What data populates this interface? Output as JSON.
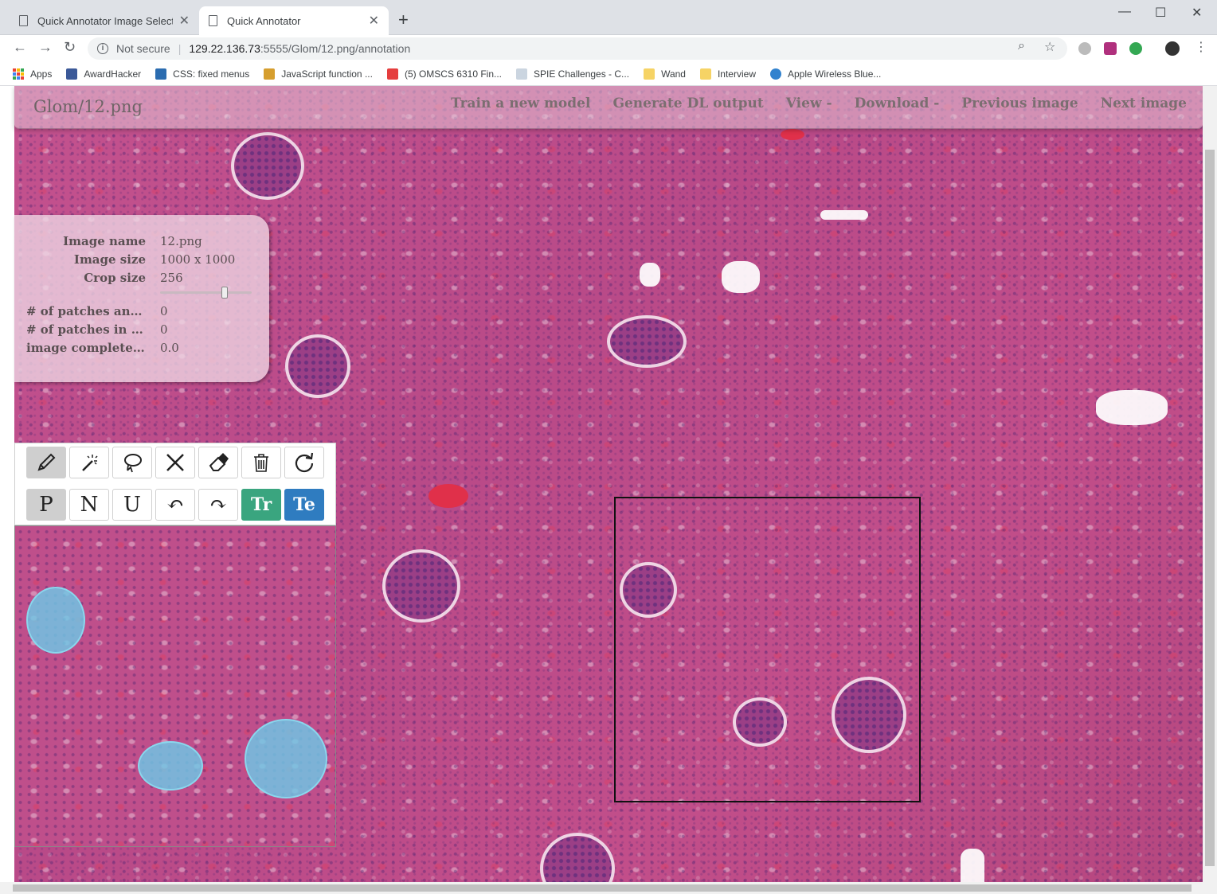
{
  "browser": {
    "tabs": [
      {
        "title": "Quick Annotator Image Selection",
        "active": false
      },
      {
        "title": "Quick Annotator",
        "active": true
      }
    ],
    "new_tab_label": "+",
    "address": {
      "security": "Not secure",
      "host": "129.22.136.73",
      "path": ":5555/Glom/12.png/annotation"
    },
    "bookmarks": [
      {
        "label": "Apps",
        "icon": "apps-grid-icon",
        "color": "#4285f4"
      },
      {
        "label": "AwardHacker",
        "icon": "arrow-icon",
        "color": "#3b5998"
      },
      {
        "label": "CSS: fixed menus",
        "icon": "w3-icon",
        "color": "#2b6cb0"
      },
      {
        "label": "JavaScript function ...",
        "icon": "js-icon",
        "color": "#d69e2e"
      },
      {
        "label": "(5) OMSCS 6310 Fin...",
        "icon": "youtube-icon",
        "color": "#e53e3e"
      },
      {
        "label": "SPIE Challenges - C...",
        "icon": "page-icon",
        "color": "#718096"
      },
      {
        "label": "Wand",
        "icon": "folder-icon",
        "color": "#f6d365"
      },
      {
        "label": "Interview",
        "icon": "folder-icon",
        "color": "#f6d365"
      },
      {
        "label": "Apple Wireless Blue...",
        "icon": "apple-icon",
        "color": "#3182ce"
      }
    ]
  },
  "app": {
    "brand": "Glom/12.png",
    "nav": [
      {
        "label": "Train a new model",
        "name": "train-model-link"
      },
      {
        "label": "Generate DL output",
        "name": "generate-dl-output-link"
      },
      {
        "label": "View -",
        "name": "view-menu"
      },
      {
        "label": "Download -",
        "name": "download-menu"
      },
      {
        "label": "Previous image",
        "name": "previous-image-link"
      },
      {
        "label": "Next image",
        "name": "next-image-link"
      }
    ],
    "info": {
      "image_name_label": "Image name",
      "image_name": "12.png",
      "image_size_label": "Image size",
      "image_size": "1000 x 1000",
      "crop_size_label": "Crop size",
      "crop_size": "256",
      "crop_slider_value": 0.72,
      "patches_annotated_label": "# of patches ann...",
      "patches_annotated": "0",
      "patches_training_label": "# of patches in t...",
      "patches_training": "0",
      "image_complete_label": "image complete %",
      "image_complete": "0.0"
    },
    "tools_row1": [
      {
        "name": "pencil-tool-button",
        "icon": "pencil-icon",
        "selected": true
      },
      {
        "name": "magic-wand-tool-button",
        "icon": "magic-wand-icon",
        "selected": false
      },
      {
        "name": "lasso-tool-button",
        "icon": "lasso-icon",
        "selected": false
      },
      {
        "name": "clear-button",
        "icon": "cross-icon",
        "selected": false
      },
      {
        "name": "eraser-tool-button",
        "icon": "eraser-icon",
        "selected": false
      },
      {
        "name": "delete-button",
        "icon": "trash-icon",
        "selected": false
      },
      {
        "name": "refresh-button",
        "icon": "refresh-icon",
        "selected": false
      }
    ],
    "tools_row2": [
      {
        "label": "P",
        "name": "positive-class-button",
        "selected": true
      },
      {
        "label": "N",
        "name": "negative-class-button",
        "selected": false
      },
      {
        "label": "U",
        "name": "unknown-class-button",
        "selected": false
      },
      {
        "label": "↶",
        "name": "undo-button",
        "selected": false
      },
      {
        "label": "↷",
        "name": "redo-button",
        "selected": false
      },
      {
        "label": "Tr",
        "name": "training-set-button",
        "color": "#3aa57f"
      },
      {
        "label": "Te",
        "name": "test-set-button",
        "color": "#2f7cc0"
      }
    ]
  }
}
